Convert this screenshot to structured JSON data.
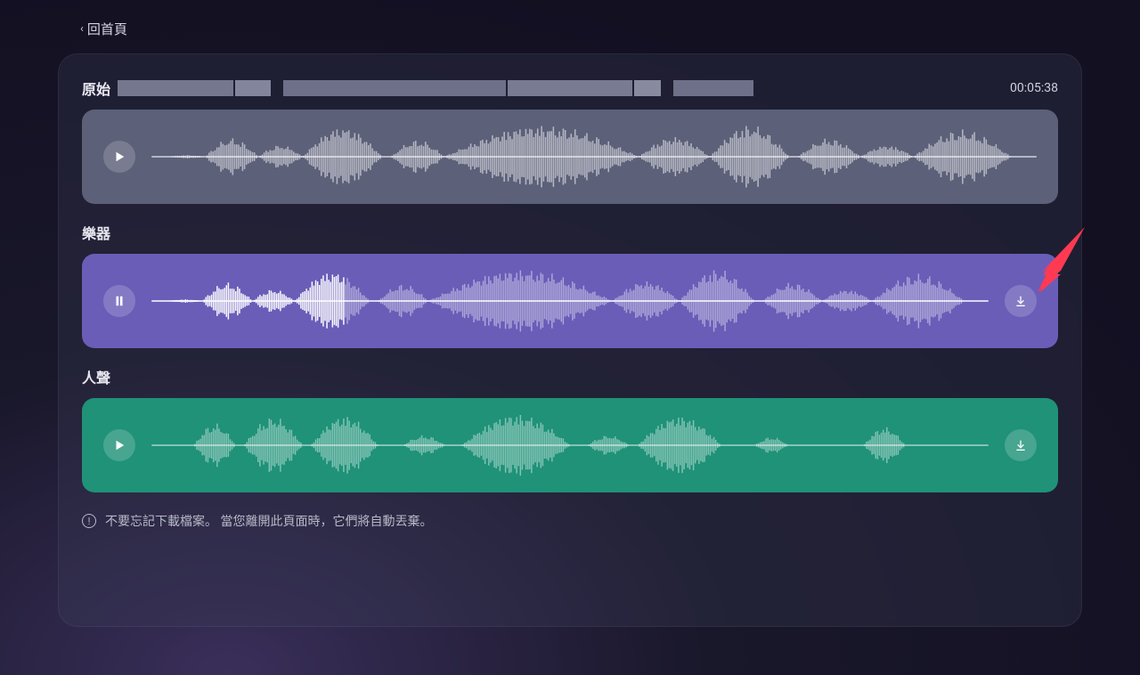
{
  "nav": {
    "back_label": "回首頁"
  },
  "duration": "00:05:38",
  "tracks": {
    "original": {
      "title": "原始"
    },
    "instruments": {
      "title": "樂器"
    },
    "vocals": {
      "title": "人聲"
    }
  },
  "footer": {
    "notice": "不要忘記下載檔案。 當您離開此頁面時，它們將自動丟棄。"
  }
}
